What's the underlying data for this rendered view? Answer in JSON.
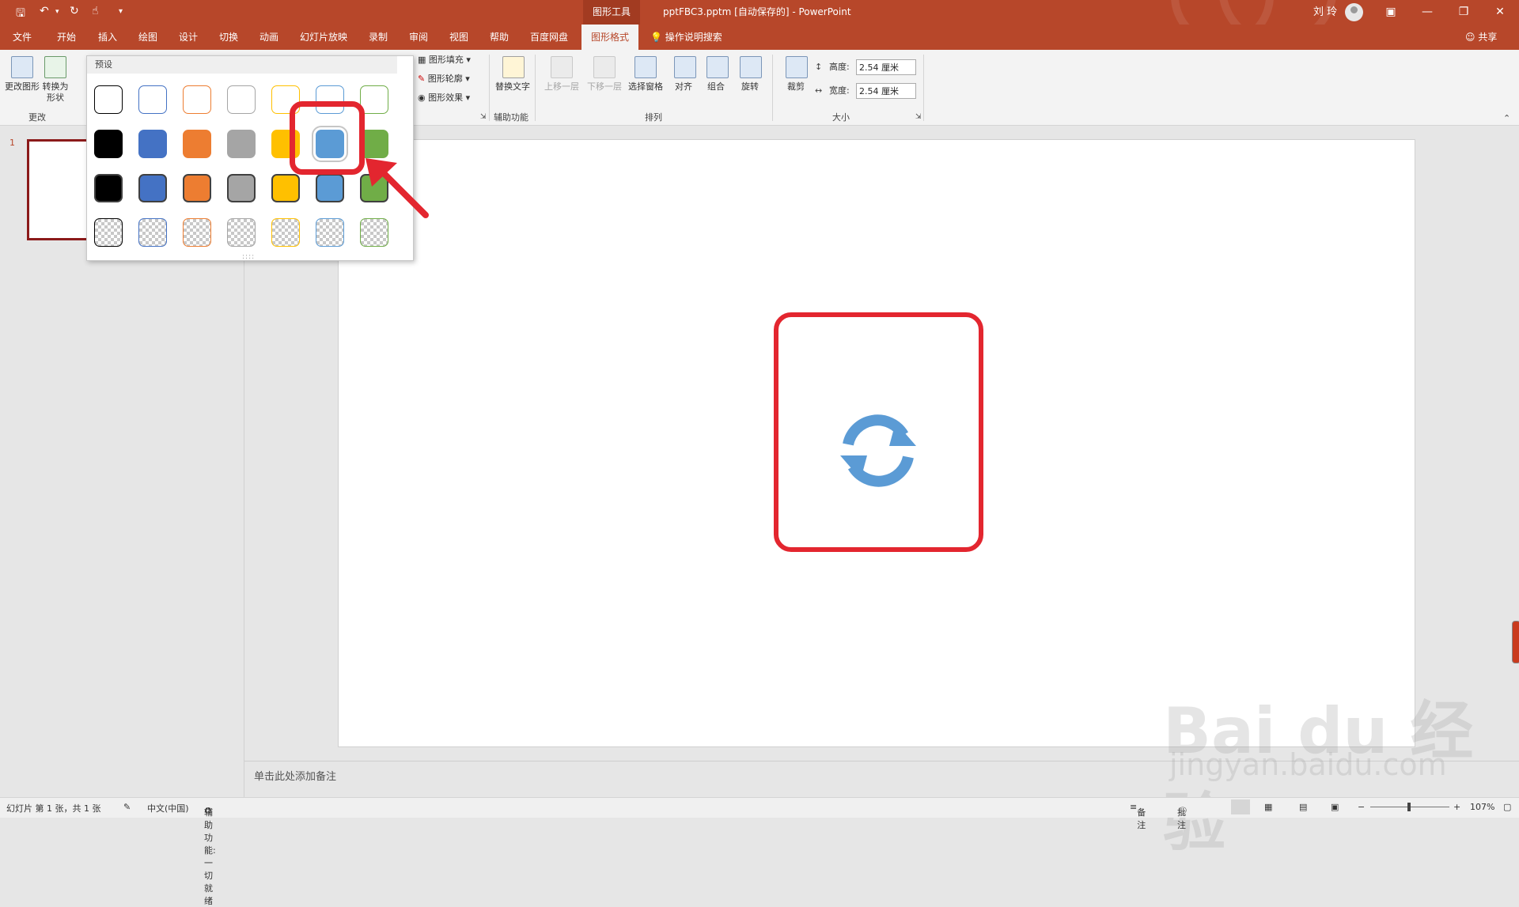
{
  "titlebar": {
    "context_tab_group": "图形工具",
    "document_title": "pptFBC3.pptm [自动保存的]  -  PowerPoint",
    "user_name": "刘 玲",
    "quick_access": [
      "save-icon",
      "undo-icon",
      "redo-icon",
      "touch-mode-icon",
      "customize-icon"
    ]
  },
  "tabs": [
    "文件",
    "开始",
    "插入",
    "绘图",
    "设计",
    "切换",
    "动画",
    "幻灯片放映",
    "录制",
    "审阅",
    "视图",
    "帮助",
    "百度网盘",
    "图形格式"
  ],
  "tell_me": "操作说明搜索",
  "share": "共享",
  "ribbon": {
    "change_graphic": "更改图形",
    "convert_shape": "转换为形状",
    "group_change": "更改",
    "fill": "图形填充",
    "outline": "图形轮廓",
    "effects": "图形效果",
    "alt_text": "替换文字",
    "group_accessibility": "辅助功能",
    "bring_forward": "上移一层",
    "send_backward": "下移一层",
    "selection_pane": "选择窗格",
    "align": "对齐",
    "group": "组合",
    "rotate": "旋转",
    "group_arrange": "排列",
    "crop": "裁剪",
    "height_label": "高度:",
    "height_value": "2.54 厘米",
    "width_label": "宽度:",
    "width_value": "2.54 厘米",
    "group_size": "大小"
  },
  "gallery": {
    "header": "预设",
    "rows": [
      {
        "style": "outline",
        "colors": [
          "#000000",
          "#4472c4",
          "#ed7d31",
          "#a5a5a5",
          "#ffc000",
          "#5b9bd5",
          "#70ad47"
        ]
      },
      {
        "style": "fill",
        "colors": [
          "#000000",
          "#4472c4",
          "#ed7d31",
          "#a5a5a5",
          "#ffc000",
          "#5b9bd5",
          "#70ad47"
        ]
      },
      {
        "style": "fill-outline",
        "colors": [
          "#000000",
          "#4472c4",
          "#ed7d31",
          "#a5a5a5",
          "#ffc000",
          "#5b9bd5",
          "#70ad47"
        ]
      },
      {
        "style": "transparent",
        "colors": [
          "#000000",
          "#4472c4",
          "#ed7d31",
          "#a5a5a5",
          "#ffc000",
          "#5b9bd5",
          "#70ad47"
        ]
      }
    ],
    "selected": {
      "row": 1,
      "col": 5
    }
  },
  "annotation_color": "#e3262f",
  "icon_color": "#5b9bd5",
  "slide": {
    "thumbnail_number": "1"
  },
  "notes_placeholder": "单击此处添加备注",
  "status": {
    "slide_info": "幻灯片 第 1 张，共 1 张",
    "language": "中文(中国)",
    "accessibility": "辅助功能: 一切就绪",
    "notes": "备注",
    "comments": "批注",
    "zoom": "107%"
  },
  "watermark": {
    "line1": "Bai du 经验",
    "line2": "jingyan.baidu.com"
  }
}
